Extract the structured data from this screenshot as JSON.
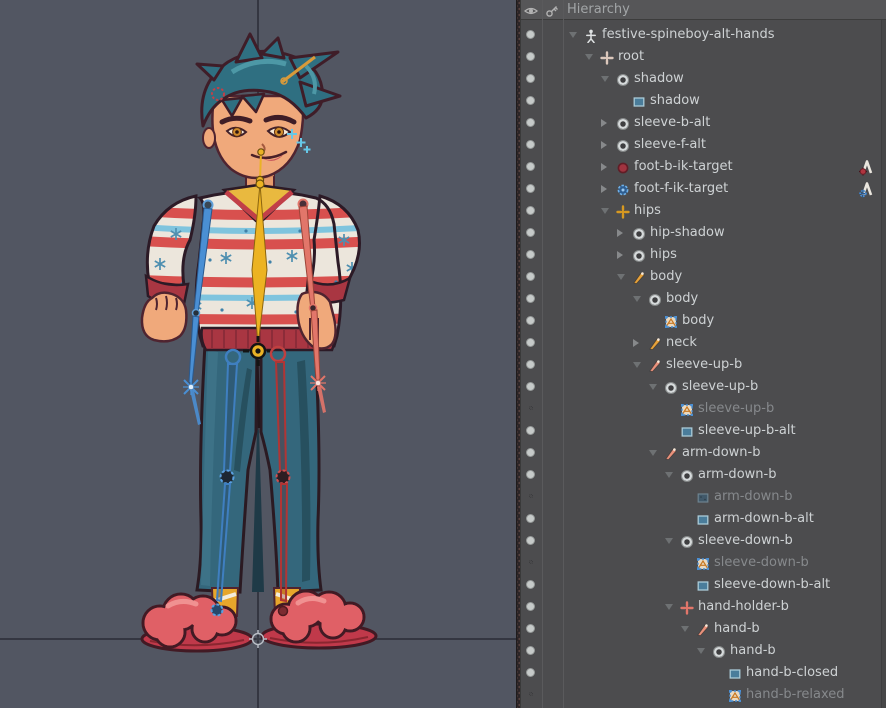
{
  "colors": {
    "viewport_bg": "#525662",
    "panel_bg": "#4c4c4e",
    "selected_bone_yellow": "#eab226",
    "front_bone_blue": "#4a8fd4",
    "back_bone_salmon": "#e2766a",
    "front_leg_blue": "#3f7fc0",
    "back_leg_red": "#c04040"
  },
  "hierarchy": {
    "header": {
      "title": "Hierarchy",
      "visibility_column_icon": "eye-icon",
      "lock_column_icon": "key-icon"
    },
    "rows": [
      {
        "label": "festive-spineboy-alt-hands",
        "level": 0,
        "arrow": "expanded",
        "icon": "skeleton",
        "dot": "on"
      },
      {
        "label": "root",
        "level": 1,
        "arrow": "expanded",
        "icon": "cross-tan",
        "dot": "on"
      },
      {
        "label": "shadow",
        "level": 2,
        "arrow": "expanded",
        "icon": "slot",
        "dot": "on"
      },
      {
        "label": "shadow",
        "level": 3,
        "arrow": "none",
        "icon": "region",
        "dot": "on"
      },
      {
        "label": "sleeve-b-alt",
        "level": 2,
        "arrow": "collapsed",
        "icon": "slot",
        "dot": "on"
      },
      {
        "label": "sleeve-f-alt",
        "level": 2,
        "arrow": "collapsed",
        "icon": "slot",
        "dot": "on"
      },
      {
        "label": "foot-b-ik-target",
        "level": 2,
        "arrow": "collapsed",
        "icon": "bone-red",
        "dot": "on",
        "right_icon": "ik-red"
      },
      {
        "label": "foot-f-ik-target",
        "level": 2,
        "arrow": "collapsed",
        "icon": "bone-blue",
        "dot": "on",
        "right_icon": "ik-blue"
      },
      {
        "label": "hips",
        "level": 2,
        "arrow": "expanded",
        "icon": "cross-gold",
        "dot": "on"
      },
      {
        "label": "hip-shadow",
        "level": 3,
        "arrow": "collapsed",
        "icon": "slot",
        "dot": "on"
      },
      {
        "label": "hips",
        "level": 3,
        "arrow": "collapsed",
        "icon": "slot",
        "dot": "on"
      },
      {
        "label": "body",
        "level": 3,
        "arrow": "expanded",
        "icon": "wedge-orange",
        "dot": "on"
      },
      {
        "label": "body",
        "level": 4,
        "arrow": "expanded",
        "icon": "slot",
        "dot": "on"
      },
      {
        "label": "body",
        "level": 5,
        "arrow": "none",
        "icon": "mesh",
        "dot": "on"
      },
      {
        "label": "neck",
        "level": 4,
        "arrow": "collapsed",
        "icon": "wedge-orange",
        "dot": "on"
      },
      {
        "label": "sleeve-up-b",
        "level": 4,
        "arrow": "expanded",
        "icon": "wedge-salmon",
        "dot": "on"
      },
      {
        "label": "sleeve-up-b",
        "level": 5,
        "arrow": "expanded",
        "icon": "slot",
        "dot": "on"
      },
      {
        "label": "sleeve-up-b",
        "level": 6,
        "arrow": "none",
        "icon": "mesh",
        "dot": "dim",
        "dim": true
      },
      {
        "label": "sleeve-up-b-alt",
        "level": 6,
        "arrow": "none",
        "icon": "region",
        "dot": "on"
      },
      {
        "label": "arm-down-b",
        "level": 5,
        "arrow": "expanded",
        "icon": "wedge-salmon",
        "dot": "on"
      },
      {
        "label": "arm-down-b",
        "level": 6,
        "arrow": "expanded",
        "icon": "slot",
        "dot": "on"
      },
      {
        "label": "arm-down-b",
        "level": 7,
        "arrow": "none",
        "icon": "region-dim",
        "dot": "dim",
        "dim": true
      },
      {
        "label": "arm-down-b-alt",
        "level": 7,
        "arrow": "none",
        "icon": "region",
        "dot": "on"
      },
      {
        "label": "sleeve-down-b",
        "level": 6,
        "arrow": "expanded",
        "icon": "slot",
        "dot": "on"
      },
      {
        "label": "sleeve-down-b",
        "level": 7,
        "arrow": "none",
        "icon": "mesh",
        "dot": "dim",
        "dim": true
      },
      {
        "label": "sleeve-down-b-alt",
        "level": 7,
        "arrow": "none",
        "icon": "region",
        "dot": "on"
      },
      {
        "label": "hand-holder-b",
        "level": 6,
        "arrow": "expanded",
        "icon": "cross-salmon",
        "dot": "on"
      },
      {
        "label": "hand-b",
        "level": 7,
        "arrow": "expanded",
        "icon": "wedge-salmon",
        "dot": "on"
      },
      {
        "label": "hand-b",
        "level": 8,
        "arrow": "expanded",
        "icon": "slot",
        "dot": "on"
      },
      {
        "label": "hand-b-closed",
        "level": 9,
        "arrow": "none",
        "icon": "region",
        "dot": "on"
      },
      {
        "label": "hand-b-relaxed",
        "level": 9,
        "arrow": "none",
        "icon": "mesh",
        "dot": "dim",
        "dim": true
      }
    ]
  }
}
